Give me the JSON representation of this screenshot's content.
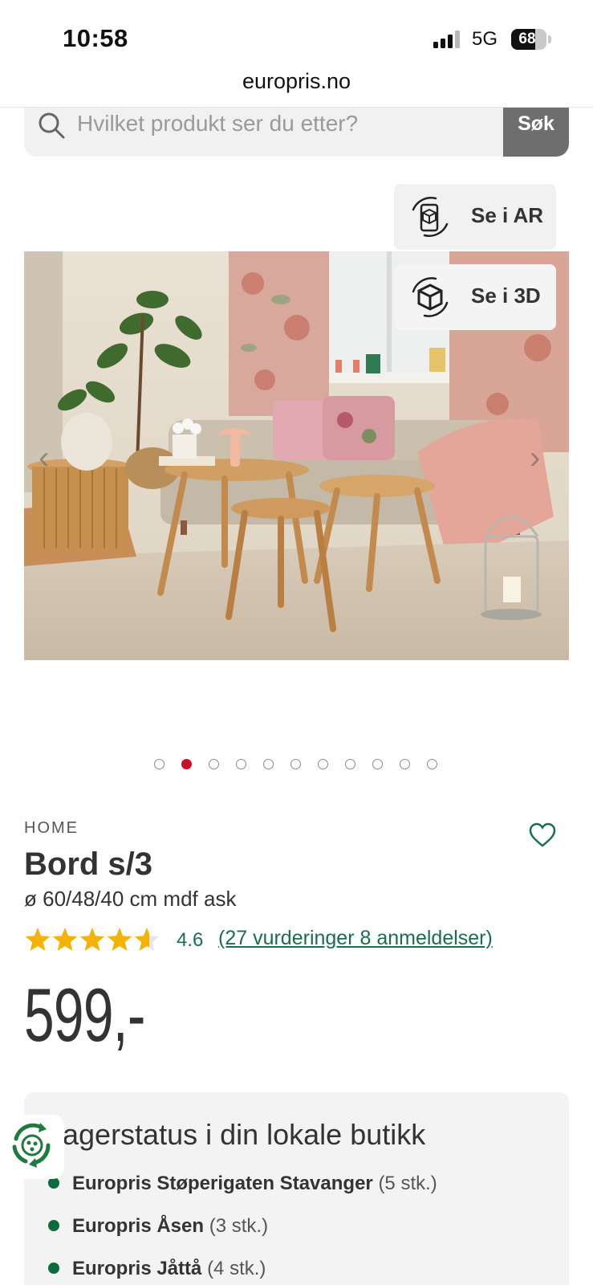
{
  "status_bar": {
    "time": "10:58",
    "network": "5G",
    "battery": "68",
    "battery_level": 0.68,
    "signal_bars": 4
  },
  "browser": {
    "url": "europris.no"
  },
  "search": {
    "placeholder": "Hvilket produkt ser du etter?",
    "button_label": "Søk"
  },
  "viewer": {
    "ar_label": "Se i AR",
    "three_d_label": "Se i 3D"
  },
  "gallery": {
    "image_count": 11,
    "active_index": 1
  },
  "product": {
    "brand": "HOME",
    "name": "Bord s/3",
    "description": "ø 60/48/40 cm mdf ask",
    "rating": "4.6",
    "rating_value": 4.6,
    "reviews_link": "(27 vurderinger 8 anmeldelser)",
    "price": "599,-"
  },
  "stock": {
    "title": "agerstatus i din lokale butikk",
    "stores": [
      {
        "name": "Europris Støperigaten Stavanger",
        "qty": "(5 stk.)"
      },
      {
        "name": "Europris Åsen",
        "qty": "(3 stk.)"
      },
      {
        "name": "Europris Jåttå",
        "qty": "(4 stk.)"
      }
    ]
  },
  "colors": {
    "accent_green": "#1a6f4a",
    "active_dot": "#c8102e",
    "star": "#f5b301",
    "search_button": "#6e6e6e"
  },
  "icons": [
    "search-icon",
    "ar-icon",
    "cube-icon",
    "chevron-left-icon",
    "chevron-right-icon",
    "heart-icon",
    "star-icon",
    "recycle-badge-icon"
  ]
}
